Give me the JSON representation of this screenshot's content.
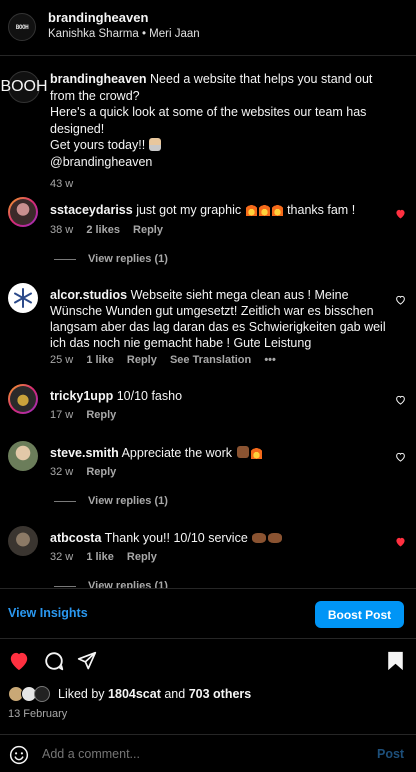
{
  "header": {
    "logo_text": "BOOH",
    "username": "brandingheaven",
    "subtitle": "Kanishka Sharma • Meri Jaan"
  },
  "caption": {
    "username": "brandingheaven",
    "text_line1": "Need a website that helps you stand out from the crowd?",
    "text_line2": "Here's a quick look at some of the websites our team has designed!",
    "text_line3": "Get yours today!!",
    "text_line4": "@brandingheaven",
    "time": "43 w"
  },
  "comments": [
    {
      "username": "sstaceydariss",
      "text_before": "just got my graphic",
      "text_after": "thanks fam !",
      "time": "38 w",
      "likes": "2 likes",
      "reply": "Reply",
      "liked": true,
      "view_replies": "View replies (1)"
    },
    {
      "username": "alcor.studios",
      "text": "Webseite sieht mega clean aus ! Meine Wünsche Wunden gut umgesetzt! Zeitlich war es bisschen langsam aber das lag daran das es Schwierigkeiten gab weil ich das noch nie gemacht habe ! Gute Leistung",
      "time": "25 w",
      "likes": "1 like",
      "reply": "Reply",
      "translation": "See Translation",
      "more": "•••",
      "liked": false
    },
    {
      "username": "tricky1upp",
      "text": "10/10 fasho",
      "time": "17 w",
      "reply": "Reply",
      "liked": false
    },
    {
      "username": "steve.smith",
      "text": "Appreciate the work",
      "time": "32 w",
      "reply": "Reply",
      "liked": false,
      "view_replies": "View replies (1)"
    },
    {
      "username": "atbcosta",
      "text": "Thank you!! 10/10 service",
      "time": "32 w",
      "likes": "1 like",
      "reply": "Reply",
      "liked": true,
      "view_replies": "View replies (1)"
    }
  ],
  "actions": {
    "view_insights": "View Insights",
    "boost_post": "Boost Post",
    "liked_by_prefix": "Liked by",
    "liked_by_user": "1804scat",
    "liked_by_and": "and",
    "liked_by_others": "703 others",
    "date": "13 February",
    "comment_placeholder": "Add a comment...",
    "post": "Post"
  },
  "colors": {
    "accent": "#0095f6",
    "heart": "#ff3040",
    "muted": "#a8a8a8"
  }
}
